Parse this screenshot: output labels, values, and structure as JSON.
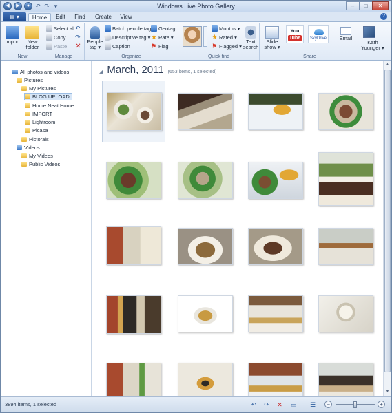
{
  "window": {
    "title": "Windows Live Photo Gallery"
  },
  "tabs": [
    {
      "label": "Home"
    },
    {
      "label": "Edit"
    },
    {
      "label": "Find"
    },
    {
      "label": "Create"
    },
    {
      "label": "View"
    }
  ],
  "ribbon": {
    "groups": {
      "new": "New",
      "manage": "Manage",
      "organize": "Organize",
      "quick_find": "Quick find",
      "share": "Share"
    },
    "new": {
      "import": "Import",
      "new_folder_l1": "New",
      "new_folder_l2": "folder"
    },
    "manage": {
      "select_all": "Select all",
      "copy": "Copy",
      "paste": "Paste"
    },
    "organize": {
      "people_tag_l1": "People",
      "people_tag_l2": "tag ▾",
      "batch_people_tag": "Batch people tag",
      "descriptive_tag": "Descriptive tag ▾",
      "caption": "Caption",
      "geotag": "Geotag",
      "rate": "Rate ▾",
      "flag": "Flag"
    },
    "quick_find": {
      "months": "Months ▾",
      "rated": "Rated ▾",
      "flagged": "Flagged ▾",
      "text_search_l1": "Text",
      "text_search_l2": "search"
    },
    "share": {
      "slide_show_l1": "Slide",
      "slide_show_l2": "show ▾",
      "youtube_l1": "You",
      "youtube_l2": "Tube",
      "skydrive": "SkyDrive",
      "email": "Email",
      "user_l1": "Kath",
      "user_l2": "Younger ▾"
    }
  },
  "nav": {
    "items": [
      {
        "label": "All photos and videos"
      },
      {
        "label": "Pictures"
      },
      {
        "label": "My Pictures"
      },
      {
        "label": "BLOG UPLOAD"
      },
      {
        "label": "Home Neat Home"
      },
      {
        "label": "IMPORT"
      },
      {
        "label": "Lightroom"
      },
      {
        "label": "Picasa"
      },
      {
        "label": "Pictorals"
      },
      {
        "label": "Videos"
      },
      {
        "label": "My Videos"
      },
      {
        "label": "Public Videos"
      }
    ]
  },
  "main": {
    "month_title": "March, 2011",
    "month_count": "(653 items, 1 selected)"
  },
  "status": {
    "text": "3894 items, 1 selected"
  },
  "zoom_level": 0.5
}
